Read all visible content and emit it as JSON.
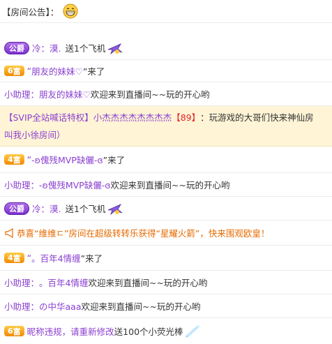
{
  "notice": {
    "label": "【房间公告】："
  },
  "messages": [
    {
      "badge": "公爵",
      "user": "冷：漠.",
      "action": "送1个飞机"
    },
    {
      "rank": "6",
      "rank_suffix": "富",
      "quote_open": "“",
      "user": "朋友的妹妹♡",
      "quote_close": "”来了"
    },
    {
      "prefix": "小助理：",
      "user": "朋友的妹妹♡",
      "text": " 欢迎来到直播间~~玩的开心哟"
    },
    {
      "svip_label": "【SVIP全站喊话特权】",
      "user": "小杰杰杰杰杰杰杰杰",
      "level": "【89】",
      "text_line1": "：玩游戏的大哥们快来神仙房",
      "text_line2": "叫我小徐房间）"
    },
    {
      "rank": "4",
      "rank_suffix": "富",
      "quote_open": "“",
      "user": "-ʚ傀残MVP缺儷-ɞ",
      "quote_close": "”来了"
    },
    {
      "prefix": "小助理：",
      "user": "-ʚ傀残MVP缺儷-ɞ",
      "text": " 欢迎来到直播间~~玩的开心哟"
    },
    {
      "badge": "公爵",
      "user": "冷：漠.",
      "action": "送1个飞机"
    },
    {
      "text": "恭喜“维维ㄷ”房间在超级转转乐获得“星耀火箭”，快来围观欧皇！"
    },
    {
      "rank": "4",
      "rank_suffix": "富",
      "quote_open": "“",
      "user": "。百年4情缠",
      "quote_close": "”来了"
    },
    {
      "prefix": "小助理：",
      "user": "。百年4情缠",
      "text": " 欢迎来到直播间~~玩的开心哟"
    },
    {
      "prefix": "小助理：",
      "user": "の中华aaa",
      "text": " 欢迎来到直播间~~玩的开心哟"
    },
    {
      "rank": "6",
      "rank_suffix": "富",
      "user": "昵称违规，请重新修改",
      "action": " 送100个小荧光棒"
    }
  ],
  "colors": {
    "purple": "#8a3fd0",
    "orange": "#e66a00",
    "red": "#e02424",
    "gold": "#f08a00"
  },
  "icons": {
    "notice_emoji": "grin-emoji-icon",
    "plane_gift": "airplane-gift-icon",
    "horn": "horn-icon",
    "wand": "glow-stick-icon"
  }
}
